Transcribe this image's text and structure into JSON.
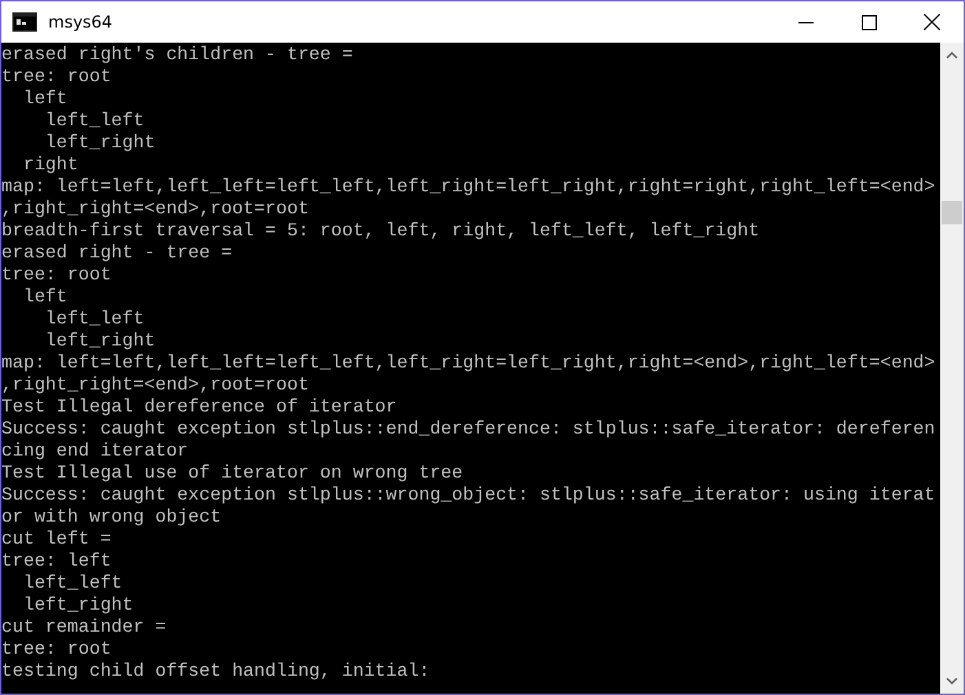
{
  "window": {
    "title": "msys64"
  },
  "console": {
    "lines": [
      "erased right's children - tree =",
      "tree: root",
      "  left",
      "    left_left",
      "    left_right",
      "  right",
      "map: left=left,left_left=left_left,left_right=left_right,right=right,right_left=<end>",
      ",right_right=<end>,root=root",
      "breadth-first traversal = 5: root, left, right, left_left, left_right",
      "erased right - tree =",
      "tree: root",
      "  left",
      "    left_left",
      "    left_right",
      "map: left=left,left_left=left_left,left_right=left_right,right=<end>,right_left=<end>",
      ",right_right=<end>,root=root",
      "Test Illegal dereference of iterator",
      "Success: caught exception stlplus::end_dereference: stlplus::safe_iterator: dereferen",
      "cing end iterator",
      "Test Illegal use of iterator on wrong tree",
      "Success: caught exception stlplus::wrong_object: stlplus::safe_iterator: using iterat",
      "or with wrong object",
      "cut left =",
      "tree: left",
      "  left_left",
      "  left_right",
      "cut remainder =",
      "tree: root",
      "testing child offset handling, initial:"
    ]
  }
}
